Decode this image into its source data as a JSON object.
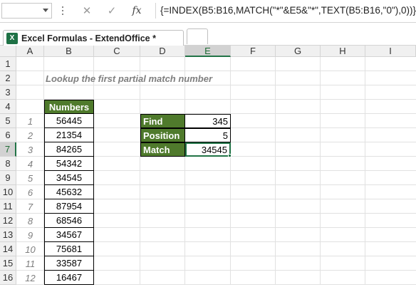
{
  "formula_bar": {
    "name_box": "",
    "cancel_icon": "✕",
    "enter_icon": "✓",
    "fx_label": "fx",
    "formula": "{=INDEX(B5:B16,MATCH(\"*\"&E5&\"*\",TEXT(B5:B16,\"0\"),0))}"
  },
  "tabs": {
    "workbook_title": "Excel Formulas - ExtendOffice *",
    "icon_letter": "X"
  },
  "columns": [
    "A",
    "B",
    "C",
    "D",
    "E",
    "F",
    "G",
    "H",
    "I"
  ],
  "rows": [
    "1",
    "2",
    "3",
    "4",
    "5",
    "6",
    "7",
    "8",
    "9",
    "10",
    "11",
    "12",
    "13",
    "14",
    "15",
    "16"
  ],
  "selected_column": "E",
  "selected_row": "7",
  "sheet": {
    "title": "Lookup the first partial match number",
    "numbers_header": "Numbers",
    "index_values": [
      "1",
      "2",
      "3",
      "4",
      "5",
      "6",
      "7",
      "8",
      "9",
      "10",
      "11",
      "12"
    ],
    "numbers": [
      "56445",
      "21354",
      "84265",
      "54342",
      "34545",
      "45632",
      "87954",
      "68546",
      "34567",
      "75681",
      "33587",
      "16467"
    ],
    "lookup": [
      {
        "label": "Find",
        "value": "345"
      },
      {
        "label": "Position",
        "value": "5"
      },
      {
        "label": "Match",
        "value": "34545"
      }
    ]
  },
  "colors": {
    "header_green": "#4f7a2c",
    "selection_green": "#217346"
  }
}
